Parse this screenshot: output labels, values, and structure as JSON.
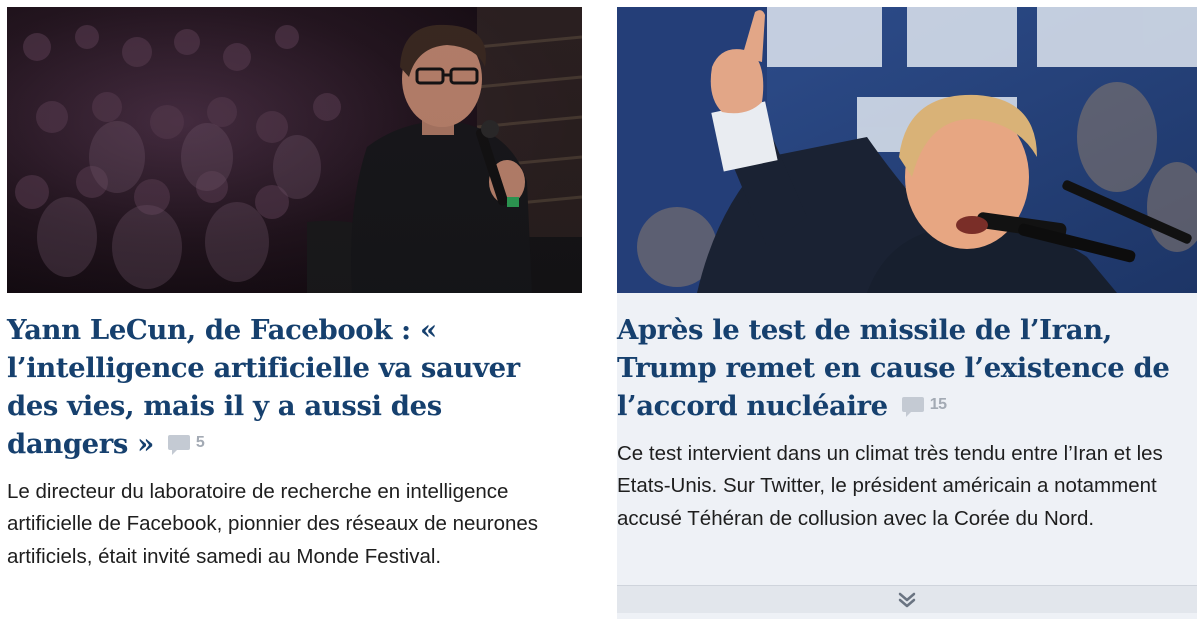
{
  "articles": [
    {
      "headline": "Yann LeCun, de Facebook : « l’intelligence artificielle va sauver des vies, mais il y a aussi des dangers »",
      "comments": "5",
      "summary": "Le directeur du laboratoire de recherche en intelligence artificielle de Facebook, pionnier des réseaux de neurones artificiels, était invité samedi au Monde Festival."
    },
    {
      "headline": "Après le test de missile de l’Iran, Trump remet en cause l’existence de l’accord nucléaire",
      "comments": "15",
      "summary": "Ce test intervient dans un climat très tendu entre l’Iran et les Etats-Unis. Sur Twitter, le président américain a notamment accusé Téhéran de collusion avec la Corée du Nord."
    }
  ],
  "icons": {
    "comment": "comment-bubble-icon",
    "expand": "double-chevron-down-icon"
  },
  "colors": {
    "headline": "#16406e",
    "summary": "#1e1e1e",
    "comment_badge": "#a3aab4",
    "card_bg_right": "#eef1f6"
  }
}
